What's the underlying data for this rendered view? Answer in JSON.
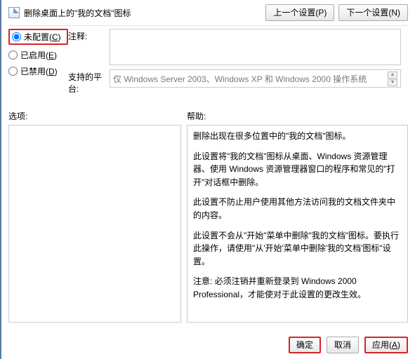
{
  "header": {
    "title": "删除桌面上的\"我的文档\"图标",
    "prev": "上一个设置(P)",
    "next": "下一个设置(N)"
  },
  "config": {
    "not_configured": "未配置(C)",
    "enabled": "已启用(E)",
    "disabled": "已禁用(D)"
  },
  "comment": {
    "label": "注释:",
    "value": ""
  },
  "platform": {
    "label": "支持的平台:",
    "value": "仅 Windows Server 2003、Windows XP 和 Windows 2000 操作系统"
  },
  "midLabels": {
    "options": "选项:",
    "help": "帮助:"
  },
  "helpText": {
    "p1": "删除出现在很多位置中的\"我的文档\"图标。",
    "p2": "此设置将\"我的文档\"图标从桌面、Windows 资源管理器、使用 Windows 资源管理器窗口的程序和常见的\"打开\"对话框中删除。",
    "p3": "此设置不防止用户使用其他方法访问我的文档文件夹中的内容。",
    "p4": "此设置不会从\"开始\"菜单中删除\"我的文档\"图标。要执行此操作，请使用\"从'开始'菜单中删除'我的文档'图标\"设置。",
    "p5": "注意: 必须注销并重新登录到 Windows 2000 Professional，才能使对于此设置的更改生效。"
  },
  "buttons": {
    "ok": "确定",
    "cancel": "取消",
    "apply": "应用(A)"
  }
}
